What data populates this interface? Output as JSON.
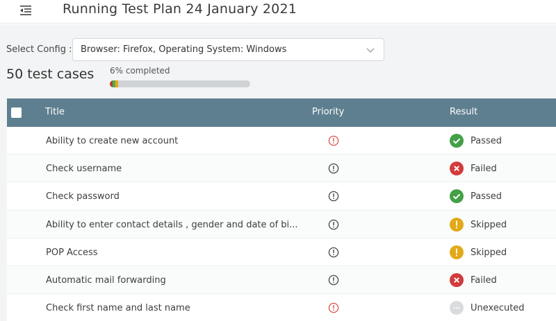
{
  "header": {
    "menu_icon": "menu-collapse-icon",
    "title": "Running Test Plan 24 January 2021"
  },
  "config": {
    "label": "Select Config :",
    "value": "Browser: Firefox, Operating System: Windows",
    "icon": "chevron-down-icon"
  },
  "summary": {
    "count_text": "50 test cases",
    "progress_text": "6% completed",
    "progress_segments": [
      {
        "status": "failed",
        "fraction": 0.02,
        "color": "#c0392b"
      },
      {
        "status": "passed",
        "fraction": 0.02,
        "color": "#4caf50"
      },
      {
        "status": "skipped",
        "fraction": 0.02,
        "color": "#e6a817"
      }
    ]
  },
  "table": {
    "columns": {
      "title": "Title",
      "priority": "Priority",
      "result": "Result"
    },
    "rows": [
      {
        "title": "Ability to create new account",
        "priority": "high",
        "result": "Passed"
      },
      {
        "title": "Check username",
        "priority": "normal",
        "result": "Failed"
      },
      {
        "title": "Check password",
        "priority": "normal",
        "result": "Passed"
      },
      {
        "title": "Ability to enter contact details , gender and date of bi...",
        "priority": "normal",
        "result": "Skipped"
      },
      {
        "title": "POP Access",
        "priority": "normal",
        "result": "Skipped"
      },
      {
        "title": "Automatic mail forwarding",
        "priority": "normal",
        "result": "Failed"
      },
      {
        "title": "Check first name and last name",
        "priority": "high",
        "result": "Unexecuted"
      }
    ]
  },
  "colors": {
    "header_bg": "#5e7f8f",
    "passed": "#43a047",
    "failed": "#d33b3b",
    "skipped": "#e2a917",
    "unexecuted": "#d9dcdf",
    "priority_high": "#d9534f",
    "priority_normal": "#444444"
  }
}
